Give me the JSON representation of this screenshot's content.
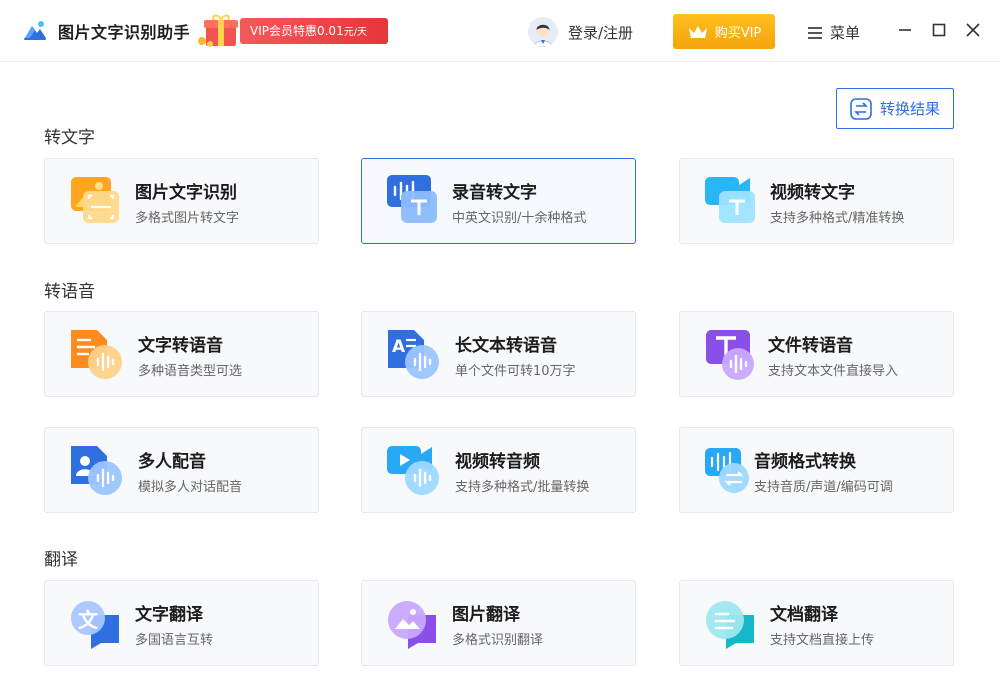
{
  "app": {
    "title": "图片文字识别助手"
  },
  "promo": {
    "text": "VIP会员特惠0.01",
    "unit": "元/天"
  },
  "user": {
    "login_label": "登录/注册"
  },
  "vip_button": {
    "label": "购买VIP"
  },
  "menu": {
    "label": "菜单"
  },
  "convert_result": {
    "label": "转换结果"
  },
  "sections": [
    {
      "title": "转文字",
      "cards": [
        {
          "title": "图片文字识别",
          "subtitle": "多格式图片转文字",
          "icon": "image-ocr-icon"
        },
        {
          "title": "录音转文字",
          "subtitle": "中英文识别/十余种格式",
          "icon": "audio-to-text-icon"
        },
        {
          "title": "视频转文字",
          "subtitle": "支持多种格式/精准转换",
          "icon": "video-to-text-icon"
        }
      ]
    },
    {
      "title": "转语音",
      "cards": [
        {
          "title": "文字转语音",
          "subtitle": "多种语音类型可选",
          "icon": "text-to-speech-icon"
        },
        {
          "title": "长文本转语音",
          "subtitle": "单个文件可转10万字",
          "icon": "long-text-to-speech-icon"
        },
        {
          "title": "文件转语音",
          "subtitle": "支持文本文件直接导入",
          "icon": "file-to-speech-icon"
        },
        {
          "title": "多人配音",
          "subtitle": "模拟多人对话配音",
          "icon": "multi-voice-icon"
        },
        {
          "title": "视频转音频",
          "subtitle": "支持多种格式/批量转换",
          "icon": "video-to-audio-icon"
        },
        {
          "title": "音频格式转换",
          "subtitle": "支持音质/声道/编码可调",
          "icon": "audio-format-icon"
        }
      ]
    },
    {
      "title": "翻译",
      "cards": [
        {
          "title": "文字翻译",
          "subtitle": "多国语言互转",
          "icon": "text-translate-icon"
        },
        {
          "title": "图片翻译",
          "subtitle": "多格式识别翻译",
          "icon": "image-translate-icon"
        },
        {
          "title": "文档翻译",
          "subtitle": "支持文档直接上传",
          "icon": "doc-translate-icon"
        }
      ]
    }
  ],
  "colors": {
    "accent": "#2f6fe0",
    "vip": "#f7ab12",
    "promo": "#e93d3f"
  }
}
